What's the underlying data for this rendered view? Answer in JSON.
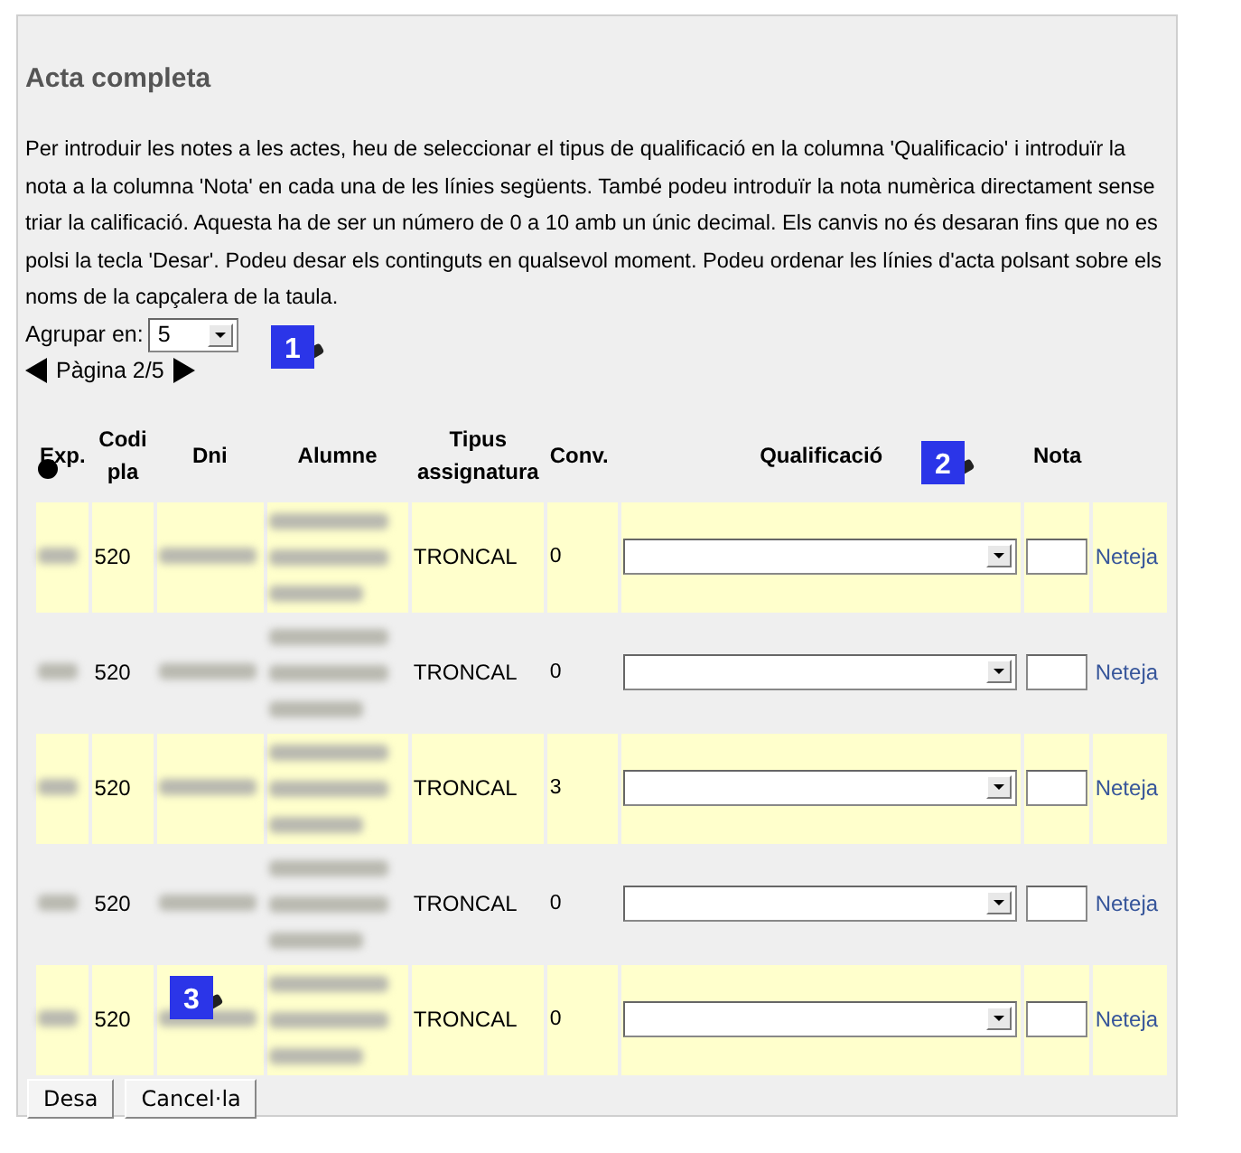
{
  "panel": {
    "title": "Acta completa",
    "instructions": "Per introduir les notes a les actes, heu de seleccionar el tipus de qualificació en la columna 'Qualificacio' i introduïr la nota a la columna 'Nota' en cada una de les línies següents. També podeu introduïr la nota numèrica directament sense triar la calificació. Aquesta ha de ser un número de 0 a 10 amb un únic decimal. Els canvis no és desaran fins que no es polsi la tecla 'Desar'. Podeu desar els continguts en qualsevol moment. Podeu ordenar les línies d'acta polsant sobre els noms de la capçalera de la taula.",
    "group_by": {
      "label": "Agrupar en:",
      "value": "5"
    },
    "pager": {
      "label": "Pàgina 2/5"
    }
  },
  "table": {
    "columns": [
      "Exp.",
      "Codi pla",
      "Dni",
      "Alumne",
      "Tipus assignatura",
      "Conv.",
      "Qualificació",
      "Nota"
    ],
    "rows": [
      {
        "codi_pla": "520",
        "tipus": "TRONCAL",
        "conv": "0",
        "action": "Neteja"
      },
      {
        "codi_pla": "520",
        "tipus": "TRONCAL",
        "conv": "0",
        "action": "Neteja"
      },
      {
        "codi_pla": "520",
        "tipus": "TRONCAL",
        "conv": "3",
        "action": "Neteja"
      },
      {
        "codi_pla": "520",
        "tipus": "TRONCAL",
        "conv": "0",
        "action": "Neteja"
      },
      {
        "codi_pla": "520",
        "tipus": "TRONCAL",
        "conv": "0",
        "action": "Neteja"
      }
    ]
  },
  "buttons": [
    "Desa",
    "Cancel·la"
  ],
  "callouts": [
    {
      "label": "1"
    },
    {
      "label": "2"
    },
    {
      "label": "3"
    }
  ]
}
